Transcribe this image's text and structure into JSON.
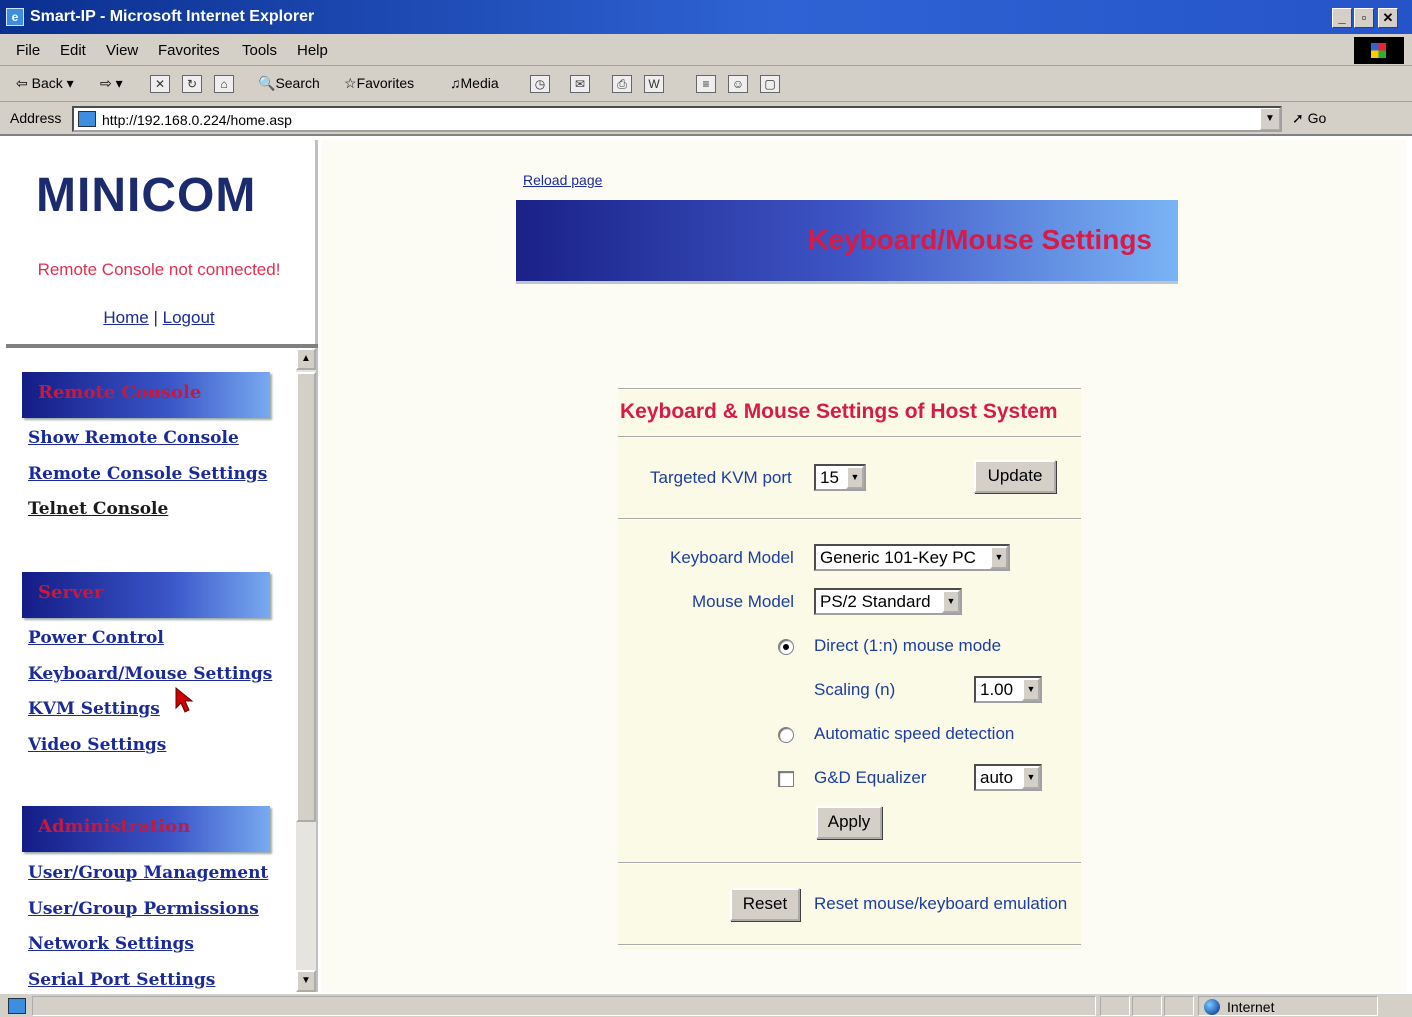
{
  "window": {
    "title": "Smart-IP - Microsoft Internet Explorer"
  },
  "menubar": {
    "items": [
      "File",
      "Edit",
      "View",
      "Favorites",
      "Tools",
      "Help"
    ]
  },
  "toolbar": {
    "back": "Back",
    "search": "Search",
    "favorites": "Favorites",
    "media": "Media"
  },
  "addressbar": {
    "label": "Address",
    "url": "http://192.168.0.224/home.asp",
    "go": "Go"
  },
  "sidebar": {
    "logo": "MINICOM",
    "status": "Remote Console not connected!",
    "home": "Home",
    "separator": "|",
    "logout": "Logout",
    "sections": [
      {
        "title": "Remote Console",
        "links": [
          "Show Remote Console",
          "Remote Console Settings",
          "Telnet Console"
        ]
      },
      {
        "title": "Server",
        "links": [
          "Power Control",
          "Keyboard/Mouse Settings",
          "KVM Settings",
          "Video Settings"
        ]
      },
      {
        "title": "Administration",
        "links": [
          "User/Group Management",
          "User/Group Permissions",
          "Network Settings",
          "Serial Port Settings"
        ]
      }
    ]
  },
  "main": {
    "reload": "Reload page",
    "banner_title": "Keyboard/Mouse Settings",
    "panel_title": "Keyboard & Mouse Settings of Host System",
    "kvm_port_label": "Targeted KVM port",
    "kvm_port_value": "15",
    "update_button": "Update",
    "keyboard_model_label": "Keyboard Model",
    "keyboard_model_value": "Generic 101-Key PC",
    "mouse_model_label": "Mouse Model",
    "mouse_model_value": "PS/2 Standard",
    "direct_mode_label": "Direct (1:n) mouse mode",
    "direct_mode_selected": true,
    "scaling_label": "Scaling (n)",
    "scaling_value": "1.00",
    "auto_speed_label": "Automatic speed detection",
    "equalizer_label": "G&D Equalizer",
    "equalizer_value": "auto",
    "apply_button": "Apply",
    "reset_button": "Reset",
    "reset_label": "Reset mouse/keyboard emulation"
  },
  "statusbar": {
    "zone": "Internet"
  }
}
